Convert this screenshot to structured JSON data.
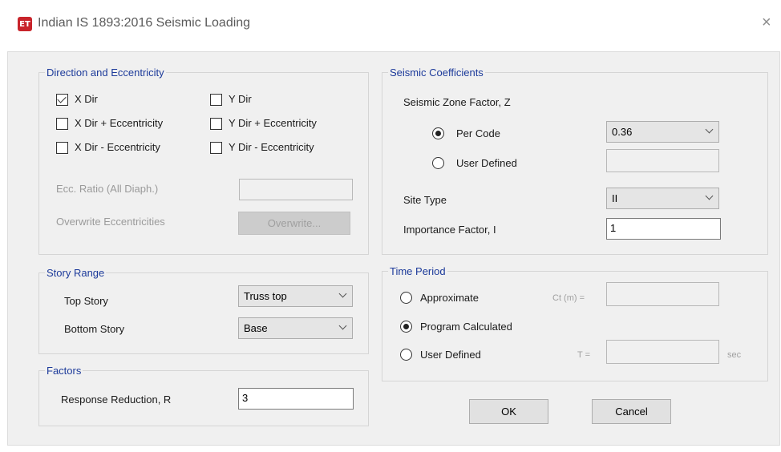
{
  "window": {
    "title": "Indian IS 1893:2016 Seismic Loading",
    "icon_text": "ET",
    "close_glyph": "×"
  },
  "direction": {
    "title": "Direction and Eccentricity",
    "x_dir": "X Dir",
    "x_dir_plus": "X Dir + Eccentricity",
    "x_dir_minus": "X Dir - Eccentricity",
    "y_dir": "Y Dir",
    "y_dir_plus": "Y Dir + Eccentricity",
    "y_dir_minus": "Y Dir - Eccentricity",
    "ecc_ratio_label": "Ecc. Ratio (All Diaph.)",
    "overwrite_label": "Overwrite Eccentricities",
    "overwrite_button": "Overwrite..."
  },
  "story_range": {
    "title": "Story Range",
    "top_label": "Top Story",
    "top_value": "Truss top",
    "bottom_label": "Bottom Story",
    "bottom_value": "Base"
  },
  "factors": {
    "title": "Factors",
    "response_label": "Response Reduction, R",
    "response_value": "3"
  },
  "seismic": {
    "title": "Seismic Coefficients",
    "zone_label": "Seismic Zone Factor, Z",
    "per_code": "Per Code",
    "zone_value": "0.36",
    "user_defined": "User Defined",
    "site_label": "Site Type",
    "site_value": "II",
    "importance_label": "Importance Factor, I",
    "importance_value": "1"
  },
  "time_period": {
    "title": "Time Period",
    "approximate": "Approximate",
    "ct_label": "Ct (m) =",
    "program": "Program Calculated",
    "user_defined": "User Defined",
    "t_label": "T =",
    "sec": "sec"
  },
  "buttons": {
    "ok": "OK",
    "cancel": "Cancel"
  }
}
